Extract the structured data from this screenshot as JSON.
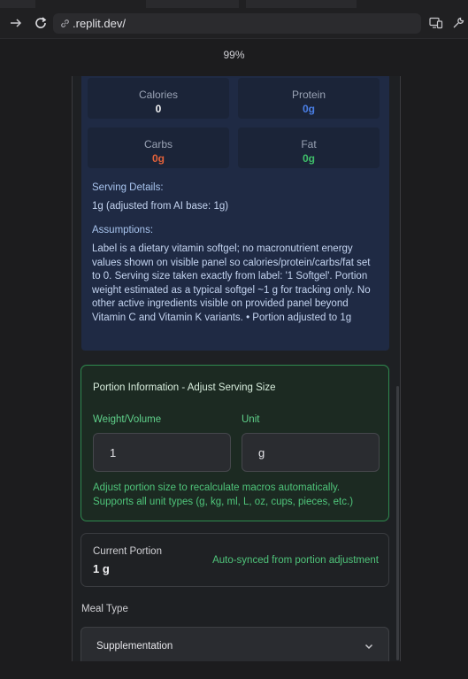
{
  "browser": {
    "url": ".replit.dev/",
    "zoom": "99%"
  },
  "nutrition": {
    "macros": [
      {
        "label": "Calories",
        "value": "0",
        "color": "#f2f2f4"
      },
      {
        "label": "Protein",
        "value": "0g",
        "color": "#4a7fe6"
      },
      {
        "label": "Carbs",
        "value": "0g",
        "color": "#e2613a"
      },
      {
        "label": "Fat",
        "value": "0g",
        "color": "#3fbf6a"
      }
    ],
    "serving_title": "Serving Details:",
    "serving_text": "1g (adjusted from AI base: 1g)",
    "assumptions_title": "Assumptions:",
    "assumptions_text": "Label is a dietary vitamin softgel; no macronutrient energy values shown on visible panel so calories/protein/carbs/fat set to 0. Serving size taken exactly from label: '1 Softgel'. Portion weight estimated as a typical softgel ~1 g for tracking only. No other active ingredients visible on provided panel beyond Vitamin C and Vitamin K variants. • Portion adjusted to 1g"
  },
  "portion": {
    "title": "Portion Information - Adjust Serving Size",
    "weight_label": "Weight/Volume",
    "weight_value": "1",
    "unit_label": "Unit",
    "unit_value": "g",
    "help_text": "Adjust portion size to recalculate macros automatically. Supports all unit types (g, kg, ml, L, oz, cups, pieces, etc.)"
  },
  "current": {
    "label": "Current Portion",
    "value": "1 g",
    "note": "Auto-synced from portion adjustment"
  },
  "meal": {
    "label": "Meal Type",
    "selected": "Supplementation"
  }
}
